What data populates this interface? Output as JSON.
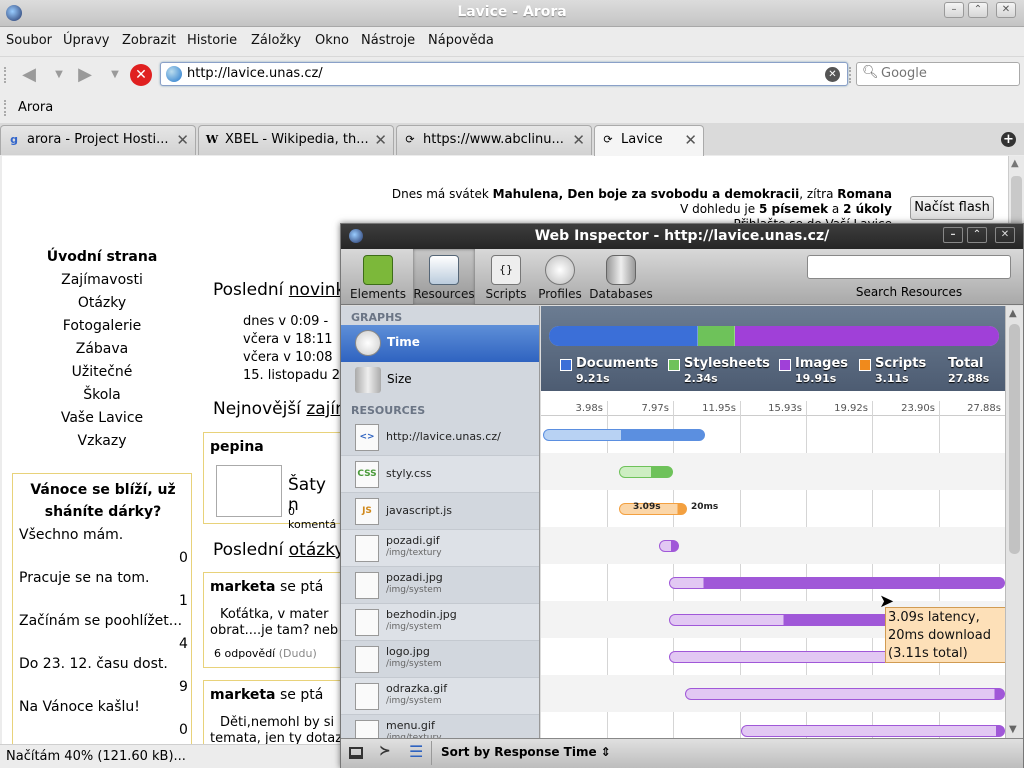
{
  "window": {
    "title": "Lavice - Arora"
  },
  "menu": [
    "Soubor",
    "Úpravy",
    "Zobrazit",
    "Historie",
    "Záložky",
    "Okno",
    "Nástroje",
    "Nápověda"
  ],
  "nav": {
    "url": "http://lavice.unas.cz/",
    "search_placeholder": "Google"
  },
  "bookmarks": {
    "item": "Arora"
  },
  "tabs": [
    {
      "label": "arora - Project Hosti..."
    },
    {
      "label": "XBEL - Wikipedia, th..."
    },
    {
      "label": "https://www.abclinu..."
    },
    {
      "label": "Lavice"
    }
  ],
  "page": {
    "holiday_line1_prefix": "Dnes má svátek ",
    "holiday_line1_name": "Mahulena, Den boje za svobodu a demokracii",
    "holiday_line1_mid": ", zítra ",
    "holiday_line1_next": "Romana",
    "holiday_line2_prefix": "V dohledu je ",
    "holiday_line2_b1": "5 písemek",
    "holiday_line2_mid": " a ",
    "holiday_line2_b2": "2 úkoly",
    "holiday_line3": "Přihlašte se do Vaší Lavice",
    "flash_button": "Načíst flash",
    "nav": [
      "Úvodní strana",
      "Zajímavosti",
      "Otázky",
      "Fotogalerie",
      "Zábava",
      "Užitečné",
      "Škola",
      "Vaše Lavice",
      "Vzkazy"
    ],
    "poll": {
      "title": "Vánoce se blíží, už sháníte dárky?",
      "options": [
        {
          "label": "Všechno mám.",
          "count": "0"
        },
        {
          "label": "Pracuje se na tom.",
          "count": "1"
        },
        {
          "label": "Začínám se poohlížet...",
          "count": "4"
        },
        {
          "label": "Do 23. 12. času dost.",
          "count": "9"
        },
        {
          "label": "Na Vánoce kašlu!",
          "count": "0"
        }
      ]
    },
    "news_heading_prefix": "Poslední ",
    "news_heading_link": "novink",
    "news_items": [
      "dnes v 0:09 -",
      "včera v 18:11",
      "včera v 10:08",
      "15. listopadu 2"
    ],
    "newest_prefix": "Nejnovější ",
    "newest_link": "zajín",
    "card1": {
      "author": "pepina",
      "title": "Šaty n",
      "comments": "0 komentá"
    },
    "questions_prefix": "Poslední ",
    "questions_link": "otázky",
    "q1": {
      "author": "marketa",
      "verb": " se ptá",
      "text": "Koťátka, v mater obrat....je tam? neb",
      "answers": "6 odpovědí",
      "by": "(Dudu)"
    },
    "q2": {
      "author": "marketa",
      "verb": " se ptá",
      "text": "Děti,nemohl by si temata, jen ty dotaz"
    }
  },
  "status": "Načítám 40% (121.60 kB)...",
  "inspector": {
    "title": "Web Inspector - http://lavice.unas.cz/",
    "tools": [
      "Elements",
      "Resources",
      "Scripts",
      "Profiles",
      "Databases"
    ],
    "search_label": "Search Resources",
    "graphs_header": "GRAPHS",
    "graphs": [
      "Time",
      "Size"
    ],
    "resources_header": "RESOURCES",
    "resources": [
      {
        "name": "http://lavice.unas.cz/",
        "path": "",
        "kind": "doc"
      },
      {
        "name": "styly.css",
        "path": "",
        "kind": "css"
      },
      {
        "name": "javascript.js",
        "path": "",
        "kind": "js"
      },
      {
        "name": "pozadi.gif",
        "path": "/img/textury",
        "kind": "img"
      },
      {
        "name": "pozadi.jpg",
        "path": "/img/system",
        "kind": "img"
      },
      {
        "name": "bezhodin.jpg",
        "path": "/img/system",
        "kind": "img"
      },
      {
        "name": "logo.jpg",
        "path": "/img/system",
        "kind": "img"
      },
      {
        "name": "odrazka.gif",
        "path": "/img/system",
        "kind": "img"
      },
      {
        "name": "menu.gif",
        "path": "/img/textury",
        "kind": "img"
      }
    ],
    "legend": [
      {
        "label": "Documents",
        "value": "9.21s",
        "color": "#3b6fd8"
      },
      {
        "label": "Stylesheets",
        "value": "2.34s",
        "color": "#6ec25a"
      },
      {
        "label": "Images",
        "value": "19.91s",
        "color": "#a040d8"
      },
      {
        "label": "Scripts",
        "value": "3.11s",
        "color": "#f08a1c"
      },
      {
        "label": "Total",
        "value": "27.88s",
        "color": ""
      }
    ],
    "ticks": [
      "3.98s",
      "7.97s",
      "11.95s",
      "15.93s",
      "19.92s",
      "23.90s",
      "27.88s"
    ],
    "js_latency_label": "3.09s",
    "js_download_label": "20ms",
    "tooltip": "3.09s latency, 20ms download (3.11s total)",
    "sort_label": "Sort by Response Time"
  }
}
